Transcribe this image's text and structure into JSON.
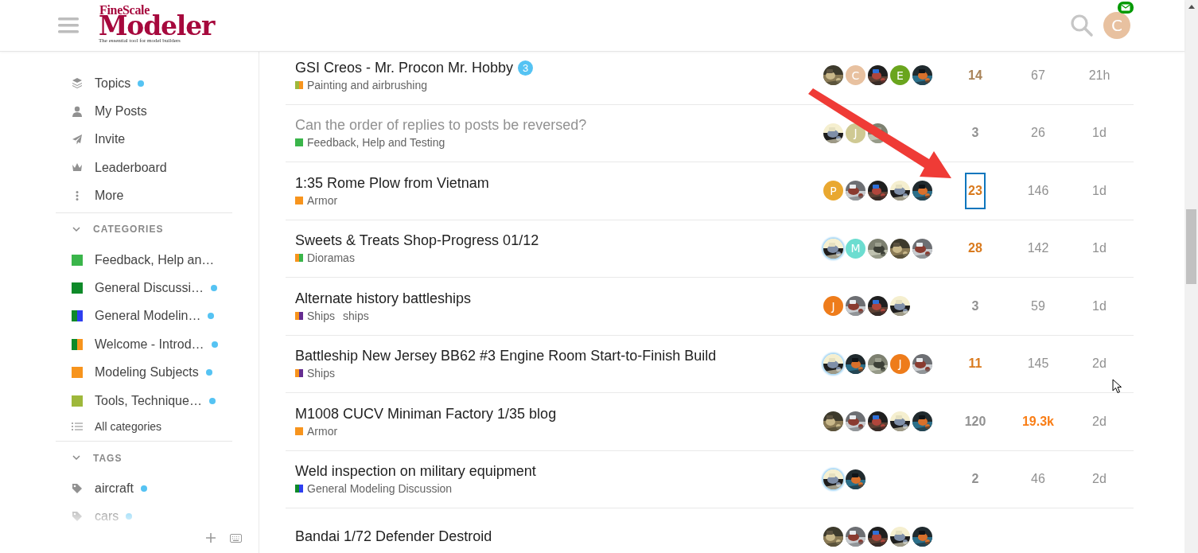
{
  "header": {
    "logo": {
      "title": "FineScale",
      "wordmark": "Modeler",
      "tagline": "The essential tool for model builders"
    },
    "user": {
      "letter": "C",
      "color": "#e8c1a0",
      "has_messages": true
    }
  },
  "sidebar": {
    "nav": [
      {
        "kind": "topics",
        "label": "Topics",
        "unread": true
      },
      {
        "kind": "posts",
        "label": "My Posts",
        "unread": false
      },
      {
        "kind": "invite",
        "label": "Invite",
        "unread": false
      },
      {
        "kind": "leaderboard",
        "label": "Leaderboard",
        "unread": false
      },
      {
        "kind": "more",
        "label": "More",
        "unread": false
      }
    ],
    "sections": [
      {
        "title": "CATEGORIES",
        "expanded": true,
        "items": [
          {
            "kind": "category",
            "label": "Feedback, Help an…",
            "color": "#3ab54a",
            "unread": false
          },
          {
            "kind": "category",
            "label": "General Discussi…",
            "color": "#0e8a29",
            "unread": true
          },
          {
            "kind": "category",
            "label": "General Modelin…",
            "parent": {
              "color": "#0e8a29"
            },
            "color": "#2e3ff0",
            "unread": true
          },
          {
            "kind": "category",
            "label": "Welcome - Introd…",
            "parent": {
              "color": "#0e8a29"
            },
            "color": "#f7941d",
            "unread": true
          },
          {
            "kind": "category",
            "label": "Modeling Subjects",
            "color": "#f7941d",
            "unread": true
          },
          {
            "kind": "category",
            "label": "Tools, Technique…",
            "color": "#9eb83b",
            "unread": true
          },
          {
            "kind": "all",
            "label": "All categories",
            "unread": false
          }
        ]
      },
      {
        "title": "TAGS",
        "expanded": true,
        "items": [
          {
            "kind": "tag",
            "label": "aircraft",
            "unread": true
          },
          {
            "kind": "tag",
            "label": "cars",
            "unread": true
          }
        ]
      }
    ]
  },
  "topics": [
    {
      "title": "GSI Creos - Mr. Procon Mr. Hobby",
      "visited": false,
      "new_count": "3",
      "category": {
        "name": "Painting and airbrushing",
        "parent": {
          "color": "#9eb83b"
        },
        "color": "#f7941d"
      },
      "posters": [
        {
          "kind": "picture"
        },
        {
          "kind": "letter",
          "letter": "C",
          "color": "#e8c1a0"
        },
        {
          "kind": "picture"
        },
        {
          "kind": "letter",
          "letter": "E",
          "color": "#6aa51e"
        },
        {
          "kind": "picture"
        }
      ],
      "replies": {
        "text": "14",
        "color": "#a9845a"
      },
      "views": {
        "text": "67",
        "color": "#919191",
        "hot": false
      },
      "activity": "21h",
      "focused": false
    },
    {
      "title": "Can the order of replies to posts be reversed?",
      "visited": true,
      "category": {
        "name": "Feedback, Help and Testing",
        "color": "#3ab54a"
      },
      "posters": [
        {
          "kind": "picture"
        },
        {
          "kind": "letter",
          "letter": "J",
          "color": "#cfc993"
        },
        {
          "kind": "picture"
        }
      ],
      "replies": {
        "text": "3",
        "color": "#919191"
      },
      "views": {
        "text": "26",
        "color": "#919191",
        "hot": false
      },
      "activity": "1d",
      "focused": false
    },
    {
      "title": "1:35 Rome Plow from Vietnam",
      "visited": false,
      "category": {
        "name": "Armor",
        "color": "#f7941d"
      },
      "posters": [
        {
          "kind": "letter",
          "letter": "P",
          "color": "#e9a830"
        },
        {
          "kind": "picture"
        },
        {
          "kind": "picture"
        },
        {
          "kind": "picture"
        },
        {
          "kind": "picture"
        }
      ],
      "replies": {
        "text": "23",
        "color": "#d97a1e"
      },
      "views": {
        "text": "146",
        "color": "#919191",
        "hot": false
      },
      "activity": "1d",
      "focused": true
    },
    {
      "title": "Sweets & Treats Shop-Progress 01/12",
      "visited": false,
      "category": {
        "name": "Dioramas",
        "parent": {
          "color": "#f7941d"
        },
        "color": "#3ab54a"
      },
      "posters": [
        {
          "kind": "picture",
          "highlighted": true
        },
        {
          "kind": "letter",
          "letter": "M",
          "color": "#6cddd0"
        },
        {
          "kind": "picture"
        },
        {
          "kind": "picture"
        },
        {
          "kind": "picture"
        }
      ],
      "replies": {
        "text": "28",
        "color": "#d97a1e"
      },
      "views": {
        "text": "142",
        "color": "#919191",
        "hot": false
      },
      "activity": "1d",
      "focused": false
    },
    {
      "title": "Alternate history battleships",
      "visited": false,
      "category": {
        "name": "Ships",
        "parent": {
          "color": "#f7941d"
        },
        "color": "#652d90"
      },
      "tags": [
        "ships"
      ],
      "posters": [
        {
          "kind": "letter",
          "letter": "J",
          "color": "#ee7c1b"
        },
        {
          "kind": "picture"
        },
        {
          "kind": "picture"
        },
        {
          "kind": "picture"
        }
      ],
      "replies": {
        "text": "3",
        "color": "#919191"
      },
      "views": {
        "text": "59",
        "color": "#919191",
        "hot": false
      },
      "activity": "1d",
      "focused": false
    },
    {
      "title": "Battleship New Jersey BB62 #3 Engine Room Start-to-Finish Build",
      "visited": false,
      "category": {
        "name": "Ships",
        "parent": {
          "color": "#f7941d"
        },
        "color": "#652d90"
      },
      "posters": [
        {
          "kind": "picture",
          "highlighted": true
        },
        {
          "kind": "picture"
        },
        {
          "kind": "picture"
        },
        {
          "kind": "letter",
          "letter": "J",
          "color": "#ee7c1b"
        },
        {
          "kind": "picture"
        }
      ],
      "replies": {
        "text": "11",
        "color": "#d97a1e"
      },
      "views": {
        "text": "145",
        "color": "#919191",
        "hot": false
      },
      "activity": "2d",
      "focused": false
    },
    {
      "title": "M1008 CUCV Miniman Factory 1/35 blog",
      "visited": false,
      "category": {
        "name": "Armor",
        "color": "#f7941d"
      },
      "posters": [
        {
          "kind": "picture"
        },
        {
          "kind": "picture"
        },
        {
          "kind": "picture"
        },
        {
          "kind": "picture"
        },
        {
          "kind": "picture"
        }
      ],
      "replies": {
        "text": "120",
        "color": "#919191"
      },
      "views": {
        "text": "19.3k",
        "color": "#f97d15",
        "hot": true
      },
      "activity": "2d",
      "focused": false
    },
    {
      "title": "Weld inspection on military equipment",
      "visited": false,
      "category": {
        "name": "General Modeling Discussion",
        "parent": {
          "color": "#0e8a29"
        },
        "color": "#2e3ff0"
      },
      "posters": [
        {
          "kind": "picture",
          "highlighted": true
        },
        {
          "kind": "picture"
        }
      ],
      "replies": {
        "text": "2",
        "color": "#919191"
      },
      "views": {
        "text": "46",
        "color": "#919191",
        "hot": false
      },
      "activity": "2d",
      "focused": false
    },
    {
      "title": "Bandai 1/72 Defender Destroid",
      "visited": false,
      "posters": [
        {
          "kind": "picture"
        },
        {
          "kind": "picture"
        },
        {
          "kind": "picture"
        },
        {
          "kind": "picture"
        },
        {
          "kind": "picture"
        }
      ]
    }
  ],
  "overlay": {
    "arrow": true,
    "cursor": true
  }
}
